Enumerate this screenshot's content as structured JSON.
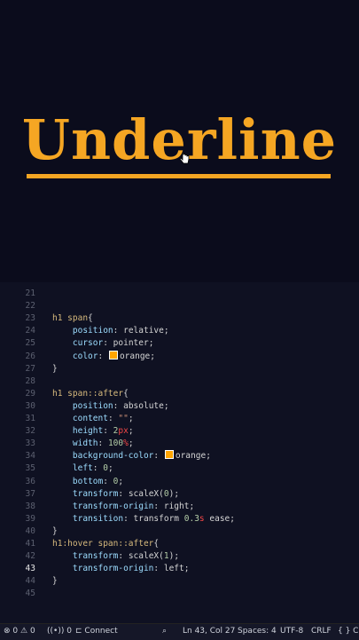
{
  "preview": {
    "heading": "Underline",
    "accent_color": "#f5a623",
    "background": "#0b0c1c"
  },
  "editor": {
    "active_line": "43",
    "lines": [
      {
        "n": "21",
        "segs": []
      },
      {
        "n": "22",
        "segs": []
      },
      {
        "n": "23",
        "segs": [
          {
            "c": "sel",
            "t": "h1 span"
          },
          {
            "c": "punct",
            "t": "{"
          }
        ]
      },
      {
        "n": "24",
        "segs": [
          {
            "c": "ind",
            "t": "    "
          },
          {
            "c": "prop",
            "t": "position"
          },
          {
            "c": "punct",
            "t": ": "
          },
          {
            "c": "val",
            "t": "relative"
          },
          {
            "c": "punct",
            "t": ";"
          }
        ]
      },
      {
        "n": "25",
        "segs": [
          {
            "c": "ind",
            "t": "    "
          },
          {
            "c": "prop",
            "t": "cursor"
          },
          {
            "c": "punct",
            "t": ": "
          },
          {
            "c": "val",
            "t": "pointer"
          },
          {
            "c": "punct",
            "t": ";"
          }
        ]
      },
      {
        "n": "26",
        "segs": [
          {
            "c": "ind",
            "t": "    "
          },
          {
            "c": "prop",
            "t": "color"
          },
          {
            "c": "punct",
            "t": ": "
          },
          {
            "c": "swatch",
            "t": ""
          },
          {
            "c": "val",
            "t": "orange"
          },
          {
            "c": "punct",
            "t": ";"
          }
        ]
      },
      {
        "n": "27",
        "segs": [
          {
            "c": "punct",
            "t": "}"
          }
        ]
      },
      {
        "n": "28",
        "segs": []
      },
      {
        "n": "29",
        "segs": [
          {
            "c": "sel",
            "t": "h1 span::after"
          },
          {
            "c": "punct",
            "t": "{"
          }
        ]
      },
      {
        "n": "30",
        "segs": [
          {
            "c": "ind",
            "t": "    "
          },
          {
            "c": "prop",
            "t": "position"
          },
          {
            "c": "punct",
            "t": ": "
          },
          {
            "c": "val",
            "t": "absolute"
          },
          {
            "c": "punct",
            "t": ";"
          }
        ]
      },
      {
        "n": "31",
        "segs": [
          {
            "c": "ind",
            "t": "    "
          },
          {
            "c": "prop",
            "t": "content"
          },
          {
            "c": "punct",
            "t": ": "
          },
          {
            "c": "str",
            "t": "\"\""
          },
          {
            "c": "punct",
            "t": ";"
          }
        ]
      },
      {
        "n": "32",
        "segs": [
          {
            "c": "ind",
            "t": "    "
          },
          {
            "c": "prop",
            "t": "height"
          },
          {
            "c": "punct",
            "t": ": "
          },
          {
            "c": "num",
            "t": "2"
          },
          {
            "c": "unit",
            "t": "px"
          },
          {
            "c": "punct",
            "t": ";"
          }
        ]
      },
      {
        "n": "33",
        "segs": [
          {
            "c": "ind",
            "t": "    "
          },
          {
            "c": "prop",
            "t": "width"
          },
          {
            "c": "punct",
            "t": ": "
          },
          {
            "c": "num",
            "t": "100"
          },
          {
            "c": "unit",
            "t": "%"
          },
          {
            "c": "punct",
            "t": ";"
          }
        ]
      },
      {
        "n": "34",
        "segs": [
          {
            "c": "ind",
            "t": "    "
          },
          {
            "c": "prop",
            "t": "background-color"
          },
          {
            "c": "punct",
            "t": ": "
          },
          {
            "c": "swatch",
            "t": ""
          },
          {
            "c": "val",
            "t": "orange"
          },
          {
            "c": "punct",
            "t": ";"
          }
        ]
      },
      {
        "n": "35",
        "segs": [
          {
            "c": "ind",
            "t": "    "
          },
          {
            "c": "prop",
            "t": "left"
          },
          {
            "c": "punct",
            "t": ": "
          },
          {
            "c": "num",
            "t": "0"
          },
          {
            "c": "punct",
            "t": ";"
          }
        ]
      },
      {
        "n": "36",
        "segs": [
          {
            "c": "ind",
            "t": "    "
          },
          {
            "c": "prop",
            "t": "bottom"
          },
          {
            "c": "punct",
            "t": ": "
          },
          {
            "c": "num",
            "t": "0"
          },
          {
            "c": "punct",
            "t": ";"
          }
        ]
      },
      {
        "n": "37",
        "segs": [
          {
            "c": "ind",
            "t": "    "
          },
          {
            "c": "prop",
            "t": "transform"
          },
          {
            "c": "punct",
            "t": ": "
          },
          {
            "c": "val",
            "t": "scaleX("
          },
          {
            "c": "num",
            "t": "0"
          },
          {
            "c": "val",
            "t": ")"
          },
          {
            "c": "punct",
            "t": ";"
          }
        ]
      },
      {
        "n": "38",
        "segs": [
          {
            "c": "ind",
            "t": "    "
          },
          {
            "c": "prop",
            "t": "transform-origin"
          },
          {
            "c": "punct",
            "t": ": "
          },
          {
            "c": "val",
            "t": "right"
          },
          {
            "c": "punct",
            "t": ";"
          }
        ]
      },
      {
        "n": "39",
        "segs": [
          {
            "c": "ind",
            "t": "    "
          },
          {
            "c": "prop",
            "t": "transition"
          },
          {
            "c": "punct",
            "t": ": "
          },
          {
            "c": "val",
            "t": "transform "
          },
          {
            "c": "num",
            "t": "0.3"
          },
          {
            "c": "unit",
            "t": "s"
          },
          {
            "c": "val",
            "t": " ease"
          },
          {
            "c": "punct",
            "t": ";"
          }
        ]
      },
      {
        "n": "40",
        "segs": [
          {
            "c": "punct",
            "t": "}"
          }
        ]
      },
      {
        "n": "41",
        "segs": [
          {
            "c": "sel",
            "t": "h1:hover span::after"
          },
          {
            "c": "punct",
            "t": "{"
          }
        ]
      },
      {
        "n": "42",
        "segs": [
          {
            "c": "ind",
            "t": "    "
          },
          {
            "c": "prop",
            "t": "transform"
          },
          {
            "c": "punct",
            "t": ": "
          },
          {
            "c": "val",
            "t": "scaleX("
          },
          {
            "c": "num",
            "t": "1"
          },
          {
            "c": "val",
            "t": ")"
          },
          {
            "c": "punct",
            "t": ";"
          }
        ]
      },
      {
        "n": "43",
        "segs": [
          {
            "c": "ind",
            "t": "    "
          },
          {
            "c": "prop",
            "t": "transform-origin"
          },
          {
            "c": "punct",
            "t": ": "
          },
          {
            "c": "val",
            "t": "left"
          },
          {
            "c": "punct",
            "t": ";"
          }
        ]
      },
      {
        "n": "44",
        "segs": [
          {
            "c": "punct",
            "t": "}"
          }
        ]
      },
      {
        "n": "45",
        "segs": []
      }
    ]
  },
  "statusbar": {
    "errors": "0",
    "warnings": "0",
    "ports": "0",
    "connect": "Connect",
    "cursor_pos": "Ln 43, Col 27",
    "spaces": "Spaces: 4",
    "encoding": "UTF-8",
    "eol": "CRLF",
    "language": "{ } CS"
  }
}
